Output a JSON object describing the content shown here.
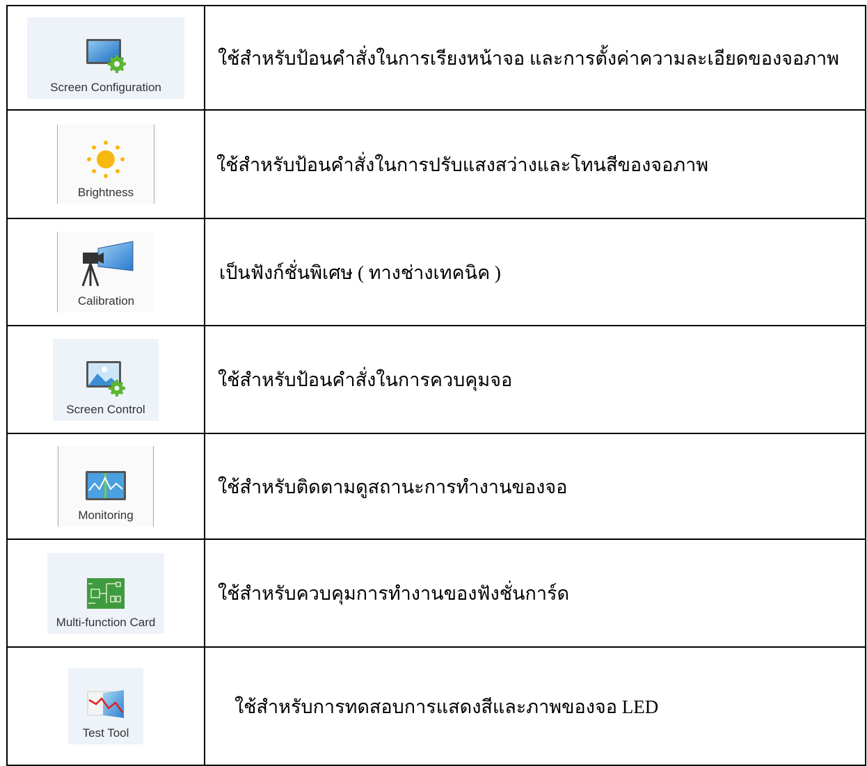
{
  "rows": [
    {
      "label": "Screen Configuration",
      "icon": "monitor-gear-icon",
      "description": "ใช้สำหรับป้อนคำสั่งในการเรียงหน้าจอ และการตั้งค่าความละเอียดของจอภาพ"
    },
    {
      "label": "Brightness",
      "icon": "sun-icon",
      "description": "ใช้สำหรับป้อนคำสั่งในการปรับแสงสว่างและโทนสีของจอภาพ"
    },
    {
      "label": "Calibration",
      "icon": "camera-tripod-icon",
      "description": "เป็นฟังก์ชั่นพิเศษ ( ทางช่างเทคนิค )"
    },
    {
      "label": "Screen Control",
      "icon": "image-gear-icon",
      "description": "ใช้สำหรับป้อนคำสั่งในการควบคุมจอ"
    },
    {
      "label": "Monitoring",
      "icon": "monitor-wave-icon",
      "description": "ใช้สำหรับติดตามดูสถานะการทำงานของจอ"
    },
    {
      "label": "Multi-function Card",
      "icon": "circuit-board-icon",
      "description": "ใช้สำหรับควบคุมการทำงานของฟังชั่นการ์ด"
    },
    {
      "label": "Test Tool",
      "icon": "line-graph-icon",
      "description": "ใช้สำหรับการทดสอบการแสดงสีและภาพของจอ LED"
    }
  ]
}
